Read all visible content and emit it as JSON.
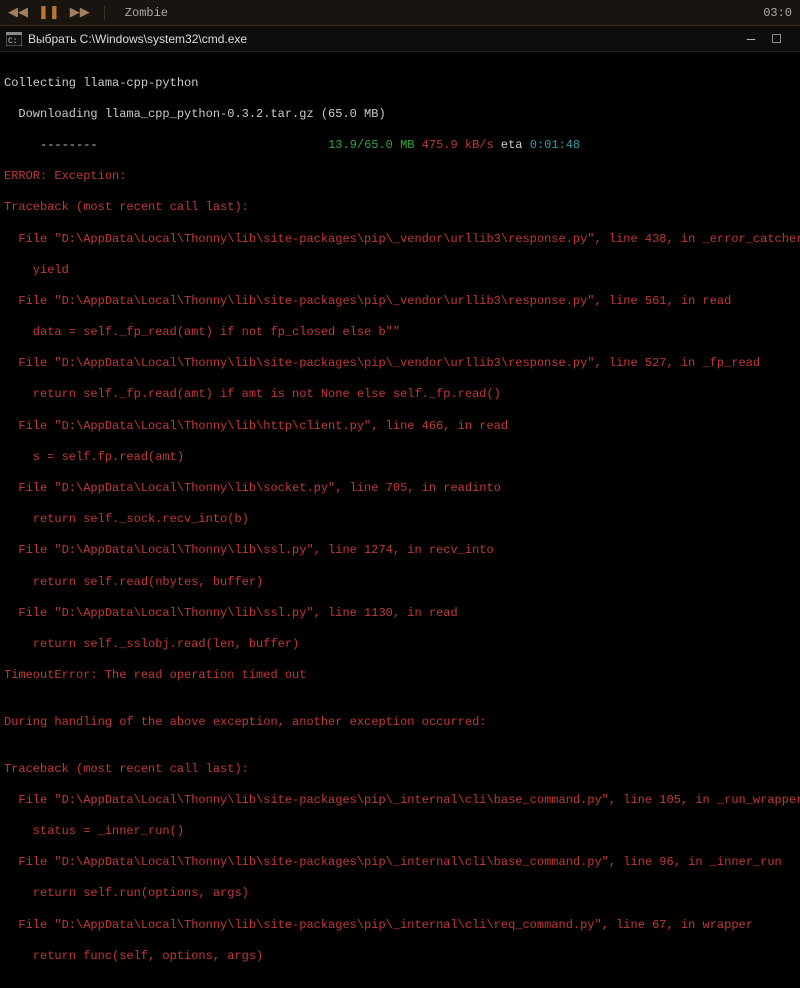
{
  "media": {
    "track": "Zombie",
    "time": "03:0"
  },
  "window": {
    "title": "Выбрать C:\\Windows\\system32\\cmd.exe"
  },
  "terminal": {
    "l0": "Collecting llama-cpp-python",
    "l1": "  Downloading llama_cpp_python-0.3.2.tar.gz (65.0 MB)",
    "progress_bar": "     --------",
    "progress_done": "                                13.9/65.0 MB",
    "progress_speed": " 475.9 kB/s",
    "progress_eta_lbl": " eta ",
    "progress_eta": "0:01:48",
    "l3": "ERROR: Exception:",
    "l4": "Traceback (most recent call last):",
    "l5": "  File \"D:\\AppData\\Local\\Thonny\\lib\\site-packages\\pip\\_vendor\\urllib3\\response.py\", line 438, in _error_catcher",
    "l6": "    yield",
    "l7": "  File \"D:\\AppData\\Local\\Thonny\\lib\\site-packages\\pip\\_vendor\\urllib3\\response.py\", line 561, in read",
    "l8": "    data = self._fp_read(amt) if not fp_closed else b\"\"",
    "l9": "  File \"D:\\AppData\\Local\\Thonny\\lib\\site-packages\\pip\\_vendor\\urllib3\\response.py\", line 527, in _fp_read",
    "l10": "    return self._fp.read(amt) if amt is not None else self._fp.read()",
    "l11": "  File \"D:\\AppData\\Local\\Thonny\\lib\\http\\client.py\", line 466, in read",
    "l12": "    s = self.fp.read(amt)",
    "l13": "  File \"D:\\AppData\\Local\\Thonny\\lib\\socket.py\", line 705, in readinto",
    "l14": "    return self._sock.recv_into(b)",
    "l15": "  File \"D:\\AppData\\Local\\Thonny\\lib\\ssl.py\", line 1274, in recv_into",
    "l16": "    return self.read(nbytes, buffer)",
    "l17": "  File \"D:\\AppData\\Local\\Thonny\\lib\\ssl.py\", line 1130, in read",
    "l18": "    return self._sslobj.read(len, buffer)",
    "l19": "TimeoutError: The read operation timed out",
    "l20": "",
    "l21": "During handling of the above exception, another exception occurred:",
    "l22": "",
    "l23": "Traceback (most recent call last):",
    "l24": "  File \"D:\\AppData\\Local\\Thonny\\lib\\site-packages\\pip\\_internal\\cli\\base_command.py\", line 105, in _run_wrapper",
    "l25": "    status = _inner_run()",
    "l26": "  File \"D:\\AppData\\Local\\Thonny\\lib\\site-packages\\pip\\_internal\\cli\\base_command.py\", line 96, in _inner_run",
    "l27": "    return self.run(options, args)",
    "l28": "  File \"D:\\AppData\\Local\\Thonny\\lib\\site-packages\\pip\\_internal\\cli\\req_command.py\", line 67, in wrapper",
    "l29": "    return func(self, options, args)"
  }
}
